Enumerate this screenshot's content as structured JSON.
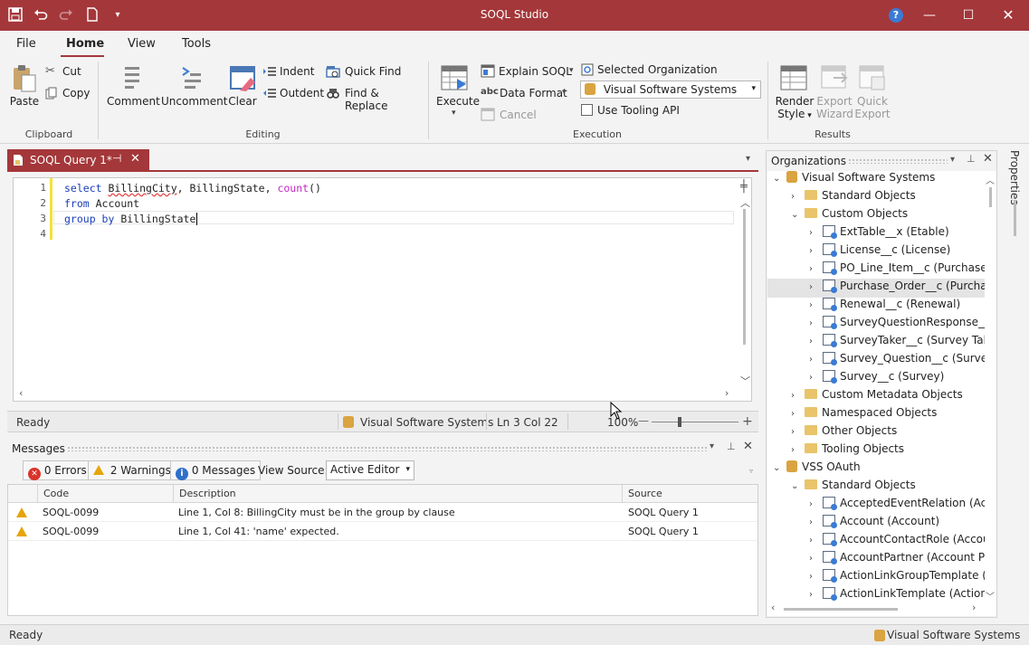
{
  "window": {
    "title": "SOQL Studio"
  },
  "menu": {
    "file": "File",
    "home": "Home",
    "view": "View",
    "tools": "Tools"
  },
  "ribbon": {
    "clipboard": {
      "paste": "Paste",
      "cut": "Cut",
      "copy": "Copy",
      "group": "Clipboard"
    },
    "editing": {
      "comment": "Comment",
      "uncomment": "Uncomment",
      "clear": "Clear",
      "indent": "Indent",
      "outdent": "Outdent",
      "quick_find": "Quick Find",
      "find_replace": "Find & Replace",
      "group": "Editing"
    },
    "execution": {
      "execute": "Execute",
      "explain": "Explain SOQL",
      "data_format": "Data Format",
      "cancel": "Cancel",
      "selected_org_label": "Selected Organization",
      "selected_org_value": "Visual Software Systems",
      "use_tooling": "Use Tooling API",
      "group": "Execution"
    },
    "results": {
      "render_style_1": "Render",
      "render_style_2": "Style",
      "export_wizard_1": "Export",
      "export_wizard_2": "Wizard",
      "quick_export_1": "Quick",
      "quick_export_2": "Export",
      "group": "Results"
    }
  },
  "document": {
    "tab_label": "SOQL Query 1*"
  },
  "editor": {
    "line_numbers": [
      "1",
      "2",
      "3",
      "4"
    ],
    "l1_select": "select",
    "l1_city": "BillingCity",
    "l1_mid": ", BillingState, ",
    "l1_count": "count",
    "l1_paren": "()",
    "l2_from": "from",
    "l2_obj": " Account",
    "l3_group": "group by",
    "l3_field": " BillingState"
  },
  "editor_status": {
    "ready": "Ready",
    "org": "Visual Software Systems",
    "position": "Ln 3 Col 22",
    "zoom": "100%"
  },
  "messages": {
    "title": "Messages",
    "errors": "0 Errors",
    "warnings": "2 Warnings",
    "infos": "0 Messages",
    "view_source_label": "View Source:",
    "view_source_value": "Active Editor",
    "columns": {
      "code": "Code",
      "description": "Description",
      "source": "Source"
    },
    "rows": [
      {
        "code": "SOQL-0099",
        "description": "Line 1, Col 8: BillingCity must be in the group by clause",
        "source": "SOQL Query 1"
      },
      {
        "code": "SOQL-0099",
        "description": "Line 1, Col 41: 'name' expected.",
        "source": "SOQL Query 1"
      }
    ]
  },
  "organizations": {
    "title": "Organizations",
    "tree": [
      {
        "label": "Visual Software Systems"
      },
      {
        "label": "Standard Objects"
      },
      {
        "label": "Custom Objects"
      },
      {
        "label": "ExtTable__x (Etable)"
      },
      {
        "label": "License__c (License)"
      },
      {
        "label": "PO_Line_Item__c (Purchase Or"
      },
      {
        "label": "Purchase_Order__c (Purchase"
      },
      {
        "label": "Renewal__c (Renewal)"
      },
      {
        "label": "SurveyQuestionResponse__c ("
      },
      {
        "label": "SurveyTaker__c (Survey Taken)"
      },
      {
        "label": "Survey_Question__c (Survey C"
      },
      {
        "label": "Survey__c (Survey)"
      },
      {
        "label": "Custom Metadata Objects"
      },
      {
        "label": "Namespaced Objects"
      },
      {
        "label": "Other Objects"
      },
      {
        "label": "Tooling Objects"
      },
      {
        "label": "VSS OAuth"
      },
      {
        "label": "Standard Objects"
      },
      {
        "label": "AcceptedEventRelation (Accep"
      },
      {
        "label": "Account (Account)"
      },
      {
        "label": "AccountContactRole (Account"
      },
      {
        "label": "AccountPartner (Account Part"
      },
      {
        "label": "ActionLinkGroupTemplate (Ac"
      },
      {
        "label": "ActionLinkTemplate (Action Li"
      }
    ]
  },
  "properties": {
    "label": "Properties"
  },
  "statusbar": {
    "ready": "Ready",
    "org": "Visual Software Systems"
  },
  "colors": {
    "accent": "#a4373a",
    "link": "#1a3eb8"
  }
}
